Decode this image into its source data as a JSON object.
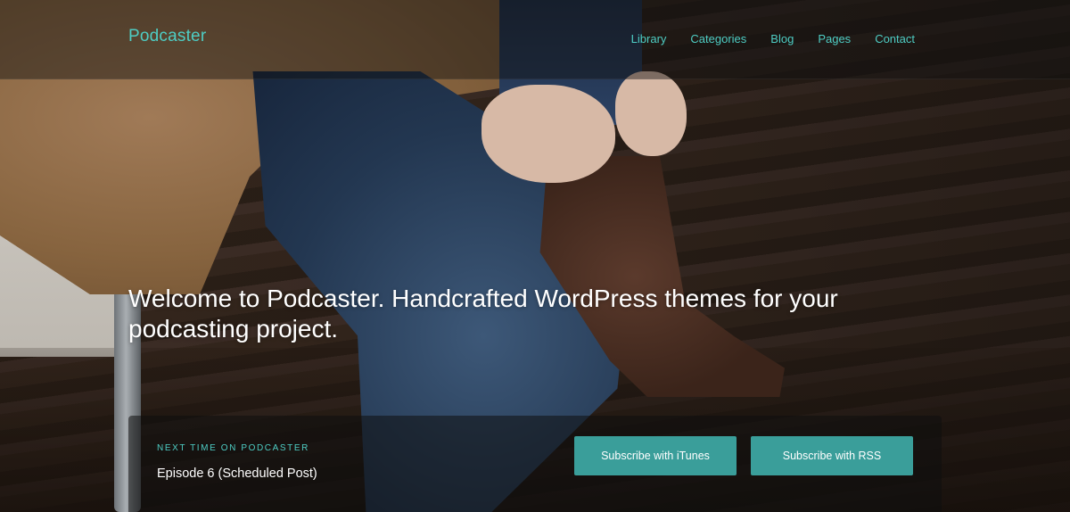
{
  "site": {
    "logo": "Podcaster"
  },
  "nav": {
    "items": [
      "Library",
      "Categories",
      "Blog",
      "Pages",
      "Contact"
    ]
  },
  "hero": {
    "headline": "Welcome to Podcaster. Handcrafted WordPress themes for your podcasting project."
  },
  "next_episode": {
    "kicker": "NEXT TIME ON PODCASTER",
    "title": "Episode 6 (Scheduled Post)"
  },
  "buttons": {
    "itunes": "Subscribe with iTunes",
    "rss": "Subscribe with RSS"
  },
  "colors": {
    "accent": "#4ecdc4",
    "button": "#3a9e9a"
  }
}
